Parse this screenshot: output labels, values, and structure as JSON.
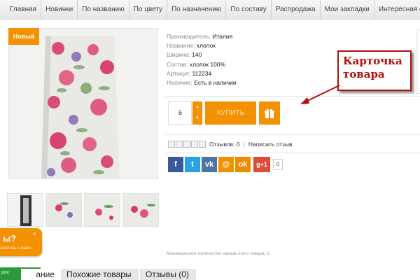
{
  "nav": {
    "items": [
      "Главная",
      "Новинки",
      "По названию",
      "По цвету",
      "По назначению",
      "По составу",
      "Распродажа",
      "Мои закладки",
      "Интересная стра"
    ]
  },
  "product": {
    "badge": "Новый",
    "specs": [
      {
        "label": "Производитель:",
        "value": "Италия"
      },
      {
        "label": "Название:",
        "value": "хлопок"
      },
      {
        "label": "Ширина:",
        "value": "140"
      },
      {
        "label": "Состав:",
        "value": "хлопок 100%"
      },
      {
        "label": "Артикул:",
        "value": "112234"
      },
      {
        "label": "Наличие:",
        "value": "Есть в наличии"
      }
    ]
  },
  "buy": {
    "quantity": "6",
    "buy_label": "КУПИТЬ"
  },
  "reviews": {
    "label": "Отзывов: 0",
    "write_label": "Написать отзыв"
  },
  "social": {
    "gplus_label": "g+1",
    "gplus_count": "0"
  },
  "min_order_text": "Минимальное количество заказа этого товара: 6",
  "annotation": {
    "line1": "Карточка",
    "line2": "товара"
  },
  "callback": {
    "question": "ы?",
    "close": "×",
    "subtitle": "зэзэтесь с нами"
  },
  "green_bar": "рос",
  "tabs": [
    "ание",
    "Похожие товары",
    "Отзывы (0)"
  ],
  "colors": {
    "accent": "#f39100",
    "annotation": "#b30d0d",
    "facebook": "#3b5998",
    "twitter": "#2aa3e6",
    "vk": "#4c75a3",
    "gplus": "#dd4b39"
  }
}
